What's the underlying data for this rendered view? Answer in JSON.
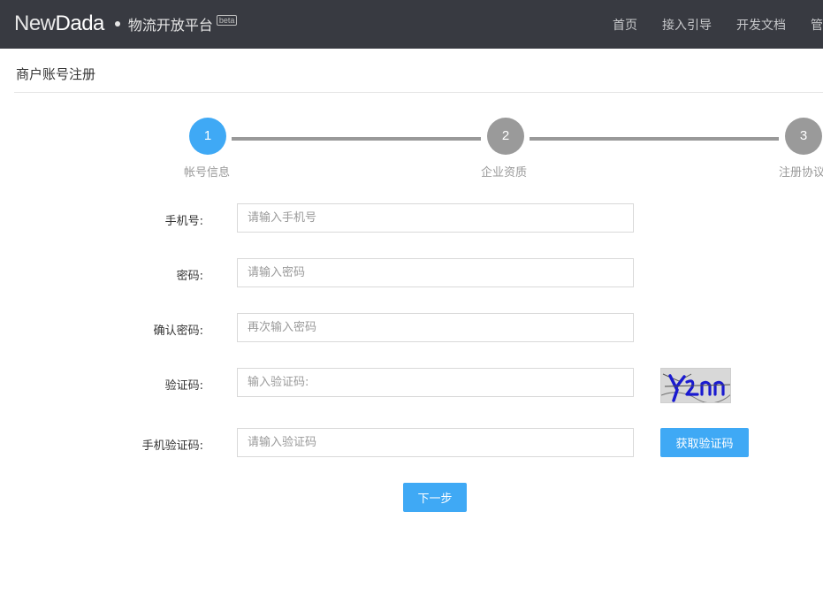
{
  "header": {
    "logo_new": "New",
    "logo_dada": "Dada",
    "subtitle": "物流开放平台",
    "beta": "beta",
    "nav": [
      "首页",
      "接入引导",
      "开发文档",
      "管理中心"
    ]
  },
  "page": {
    "title": "商户账号注册"
  },
  "steps": [
    {
      "number": "1",
      "label": "帐号信息",
      "active": true
    },
    {
      "number": "2",
      "label": "企业资质",
      "active": false
    },
    {
      "number": "3",
      "label": "注册协议",
      "active": false
    }
  ],
  "form": {
    "phone": {
      "label": "手机号:",
      "placeholder": "请输入手机号",
      "value": ""
    },
    "password": {
      "label": "密码:",
      "placeholder": "请输入密码",
      "value": ""
    },
    "confirm_password": {
      "label": "确认密码:",
      "placeholder": "再次输入密码",
      "value": ""
    },
    "captcha": {
      "label": "验证码:",
      "placeholder": "输入验证码:",
      "value": "",
      "image_text": "Y2nn"
    },
    "sms_code": {
      "label": "手机验证码:",
      "placeholder": "请输入验证码",
      "value": ""
    },
    "get_code_button": "获取验证码",
    "next_button": "下一步"
  },
  "colors": {
    "header_bg": "#383a41",
    "accent": "#3fa9f5",
    "step_inactive": "#9a9a9a"
  }
}
